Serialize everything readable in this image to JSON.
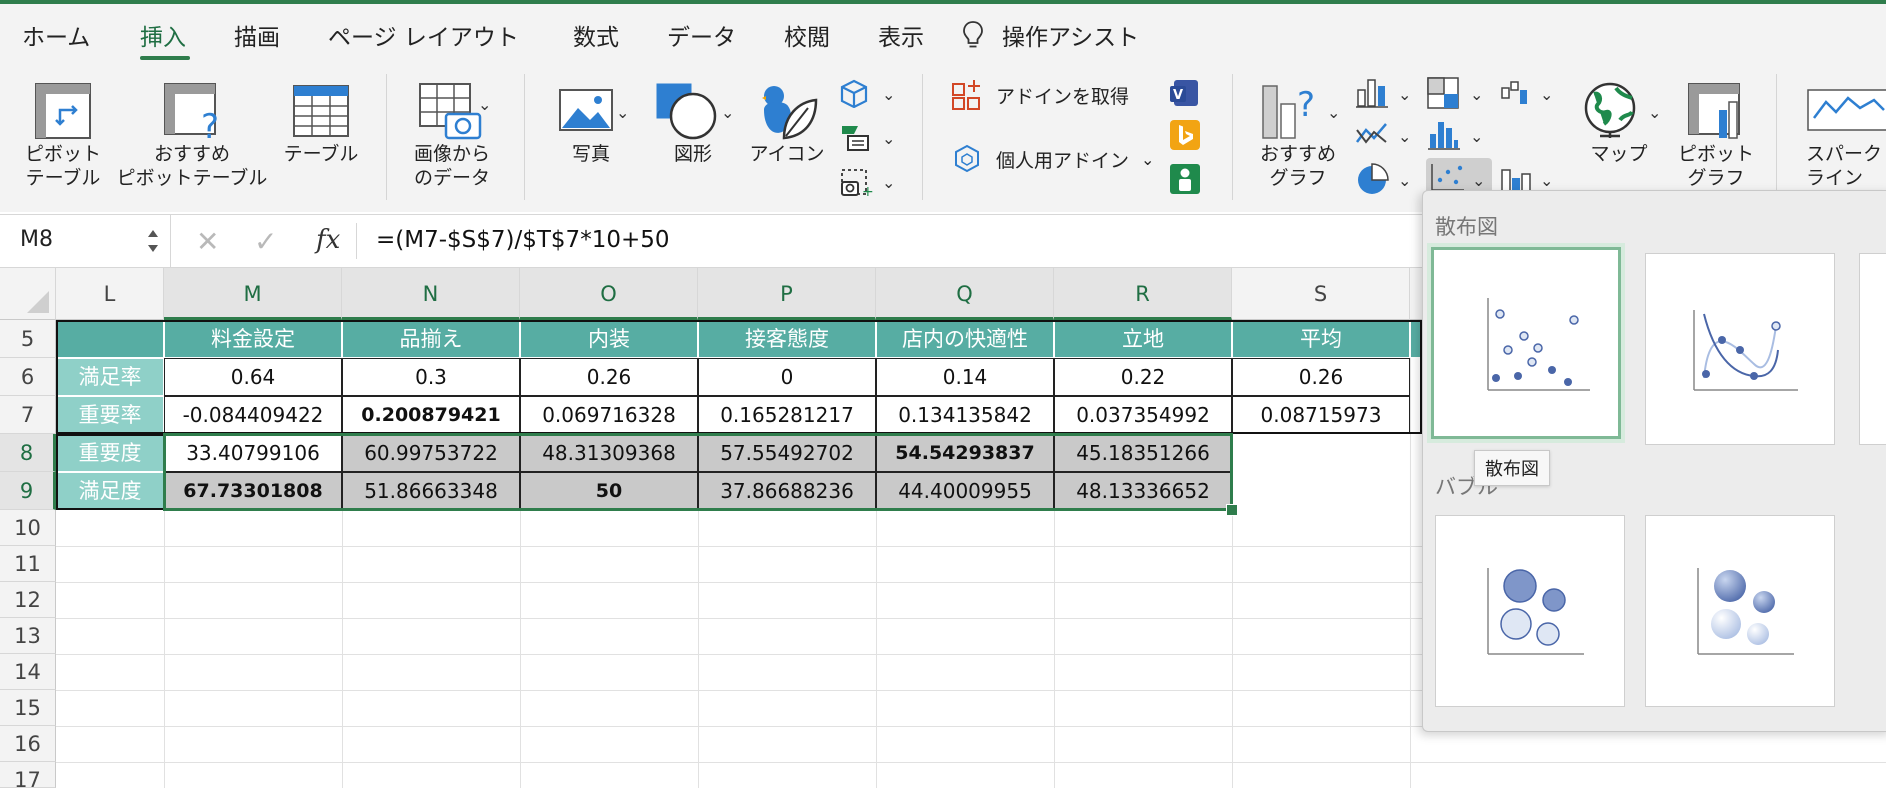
{
  "ribbon_tabs": [
    "ホーム",
    "挿入",
    "描画",
    "ページ レイアウト",
    "数式",
    "データ",
    "校閲",
    "表示"
  ],
  "active_tab": "挿入",
  "assist_label": "操作アシスト",
  "ribbon": {
    "pivot_table": [
      "ピボット",
      "テーブル"
    ],
    "recommended_pivot": [
      "おすすめ",
      "ピボットテーブル"
    ],
    "table": "テーブル",
    "data_from_picture": [
      "画像から",
      "のデータ"
    ],
    "photo": "写真",
    "shapes": "図形",
    "icons": "アイコン",
    "get_addins": "アドインを取得",
    "my_addins": "個人用アドイン",
    "recommended_charts": [
      "おすすめ",
      "グラフ"
    ],
    "maps": "マップ",
    "pivot_chart": [
      "ピボット",
      "グラフ"
    ],
    "sparklines": [
      "スパーク",
      "ライン"
    ]
  },
  "formula_bar": {
    "name_box": "M8",
    "formula": "=(M7-$S$7)/$T$7*10+50"
  },
  "columns": [
    "L",
    "M",
    "N",
    "O",
    "P",
    "Q",
    "R",
    "S"
  ],
  "rows": [
    "5",
    "6",
    "7",
    "8",
    "9",
    "10",
    "11",
    "12",
    "13",
    "14",
    "15",
    "16",
    "17"
  ],
  "table": {
    "headers": [
      "料金設定",
      "品揃え",
      "内装",
      "接客態度",
      "店内の快適性",
      "立地",
      "平均"
    ],
    "row_labels": [
      "満足率",
      "重要率",
      "重要度",
      "満足度"
    ],
    "rows": [
      [
        "0.64",
        "0.3",
        "0.26",
        "0",
        "0.14",
        "0.22",
        "0.26"
      ],
      [
        "-0.084409422",
        "0.200879421",
        "0.069716328",
        "0.165281217",
        "0.134135842",
        "0.037354992",
        "0.08715973"
      ],
      [
        "33.40799106",
        "60.99753722",
        "48.31309368",
        "57.55492702",
        "54.54293837",
        "45.18351266",
        ""
      ],
      [
        "67.73301808",
        "51.86663348",
        "50",
        "37.86688236",
        "44.40009955",
        "48.13336652",
        ""
      ]
    ]
  },
  "gallery": {
    "section_scatter": "散布図",
    "section_bubble": "バブル",
    "tooltip": "散布図"
  },
  "colors": {
    "accent": "#2f7d4c",
    "header_teal": "#57ada3",
    "label_teal": "#8fd0c8",
    "selected_gray": "#c9c9c9"
  }
}
